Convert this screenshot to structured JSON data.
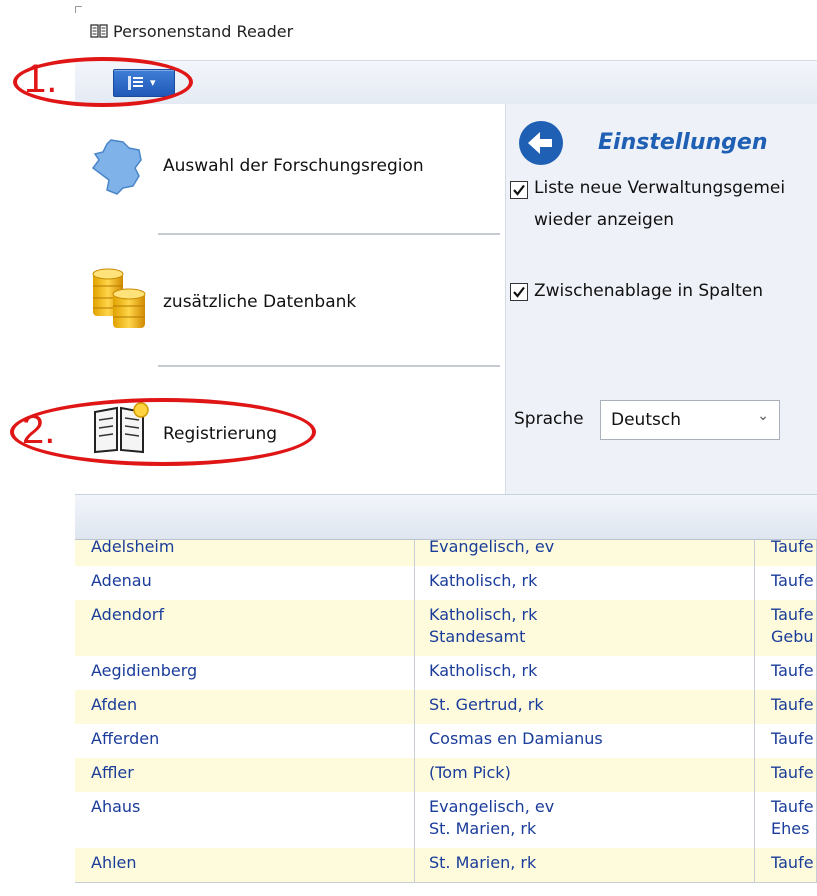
{
  "window": {
    "title": "Personenstand Reader"
  },
  "ribbon": {
    "menu_button_icon": "list-menu-icon",
    "menu_button_caret": "▾"
  },
  "nav": {
    "items": [
      {
        "label": "Auswahl der Forschungsregion",
        "icon": "germany-map-icon"
      },
      {
        "label": "zusätzliche Datenbank",
        "icon": "gold-coins-database-icon"
      },
      {
        "label": "Registrierung",
        "icon": "book-key-icon"
      }
    ]
  },
  "settings": {
    "title": "Einstellungen",
    "options": [
      {
        "line1": "Liste neue Verwaltungsgemei",
        "line2": "wieder anzeigen",
        "checked": true
      },
      {
        "line1": "Zwischenablage in Spalten",
        "checked": true
      }
    ],
    "language_label": "Sprache",
    "language_value": "Deutsch"
  },
  "annotations": {
    "step1": "1.",
    "step2": "2.",
    "color": "#e01515"
  },
  "table": {
    "rows": [
      {
        "place": "Adelsheim",
        "lines": [
          "Evangelisch, ev"
        ],
        "types": [
          "Taufe"
        ],
        "bg": "yellow"
      },
      {
        "place": "Adenau",
        "lines": [
          "Katholisch, rk"
        ],
        "types": [
          "Taufe"
        ],
        "bg": "white"
      },
      {
        "place": "Adendorf",
        "lines": [
          "Katholisch, rk",
          "Standesamt"
        ],
        "types": [
          "Taufe",
          "Gebu"
        ],
        "bg": "yellow"
      },
      {
        "place": "Aegidienberg",
        "lines": [
          "Katholisch, rk"
        ],
        "types": [
          "Taufe"
        ],
        "bg": "white"
      },
      {
        "place": "Afden",
        "lines": [
          "St. Gertrud, rk"
        ],
        "types": [
          "Taufe"
        ],
        "bg": "yellow"
      },
      {
        "place": "Afferden",
        "lines": [
          "Cosmas en Damianus"
        ],
        "types": [
          "Taufe"
        ],
        "bg": "white"
      },
      {
        "place": "Affler",
        "lines": [
          "(Tom Pick)"
        ],
        "types": [
          "Taufe"
        ],
        "bg": "yellow"
      },
      {
        "place": "Ahaus",
        "lines": [
          "Evangelisch, ev",
          "St. Marien, rk"
        ],
        "types": [
          "Taufe",
          "Ehes"
        ],
        "bg": "white"
      },
      {
        "place": "Ahlen",
        "lines": [
          "St. Marien, rk"
        ],
        "types": [
          "Taufe"
        ],
        "bg": "yellow"
      }
    ]
  }
}
